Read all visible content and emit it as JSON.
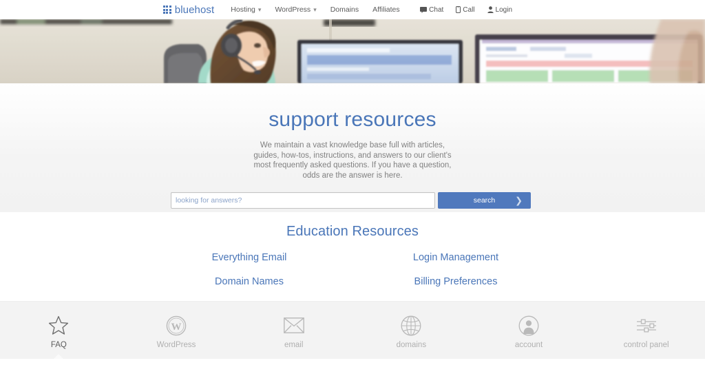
{
  "header": {
    "logo": {
      "name": "bluehost",
      "icon": "grid-dots-icon"
    },
    "nav_items": [
      {
        "label": "Hosting",
        "has_dropdown": true,
        "caret": "▾"
      },
      {
        "label": "WordPress",
        "has_dropdown": true,
        "caret": "▾"
      },
      {
        "label": "Domains",
        "has_dropdown": false,
        "caret": ""
      },
      {
        "label": "Affiliates",
        "has_dropdown": false,
        "caret": ""
      }
    ],
    "utility_items": [
      {
        "label": "Chat",
        "icon": "chat-bubble-icon"
      },
      {
        "label": "Call",
        "icon": "phone-icon"
      },
      {
        "label": "Login",
        "icon": "user-icon"
      }
    ]
  },
  "hero": {
    "banner_alt": "support agent with headset at desk with monitors",
    "title": "support resources",
    "description": "We maintain a vast knowledge base full with articles, guides, how-tos, instructions, and answers to our client's most frequently asked questions. If you have a question, odds are the answer is here.",
    "search": {
      "placeholder": "looking for answers?",
      "value": "",
      "button_label": "search",
      "button_icon": "chevron-right-icon"
    }
  },
  "education": {
    "title": "Education Resources",
    "links": [
      "Everything Email",
      "Login Management",
      "Domain Names",
      "Billing Preferences"
    ]
  },
  "iconbar": {
    "items": [
      {
        "label": "FAQ",
        "icon": "star-icon",
        "active": true
      },
      {
        "label": "WordPress",
        "icon": "wordpress-icon",
        "active": false
      },
      {
        "label": "email",
        "icon": "envelope-icon",
        "active": false
      },
      {
        "label": "domains",
        "icon": "globe-icon",
        "active": false
      },
      {
        "label": "account",
        "icon": "user-circle-icon",
        "active": false
      },
      {
        "label": "control panel",
        "icon": "sliders-icon",
        "active": false
      }
    ]
  },
  "colors": {
    "brand_blue": "#4a76b8",
    "button_blue": "#5079bd",
    "body_gray": "#818181",
    "panel_gray": "#f3f3f3"
  }
}
